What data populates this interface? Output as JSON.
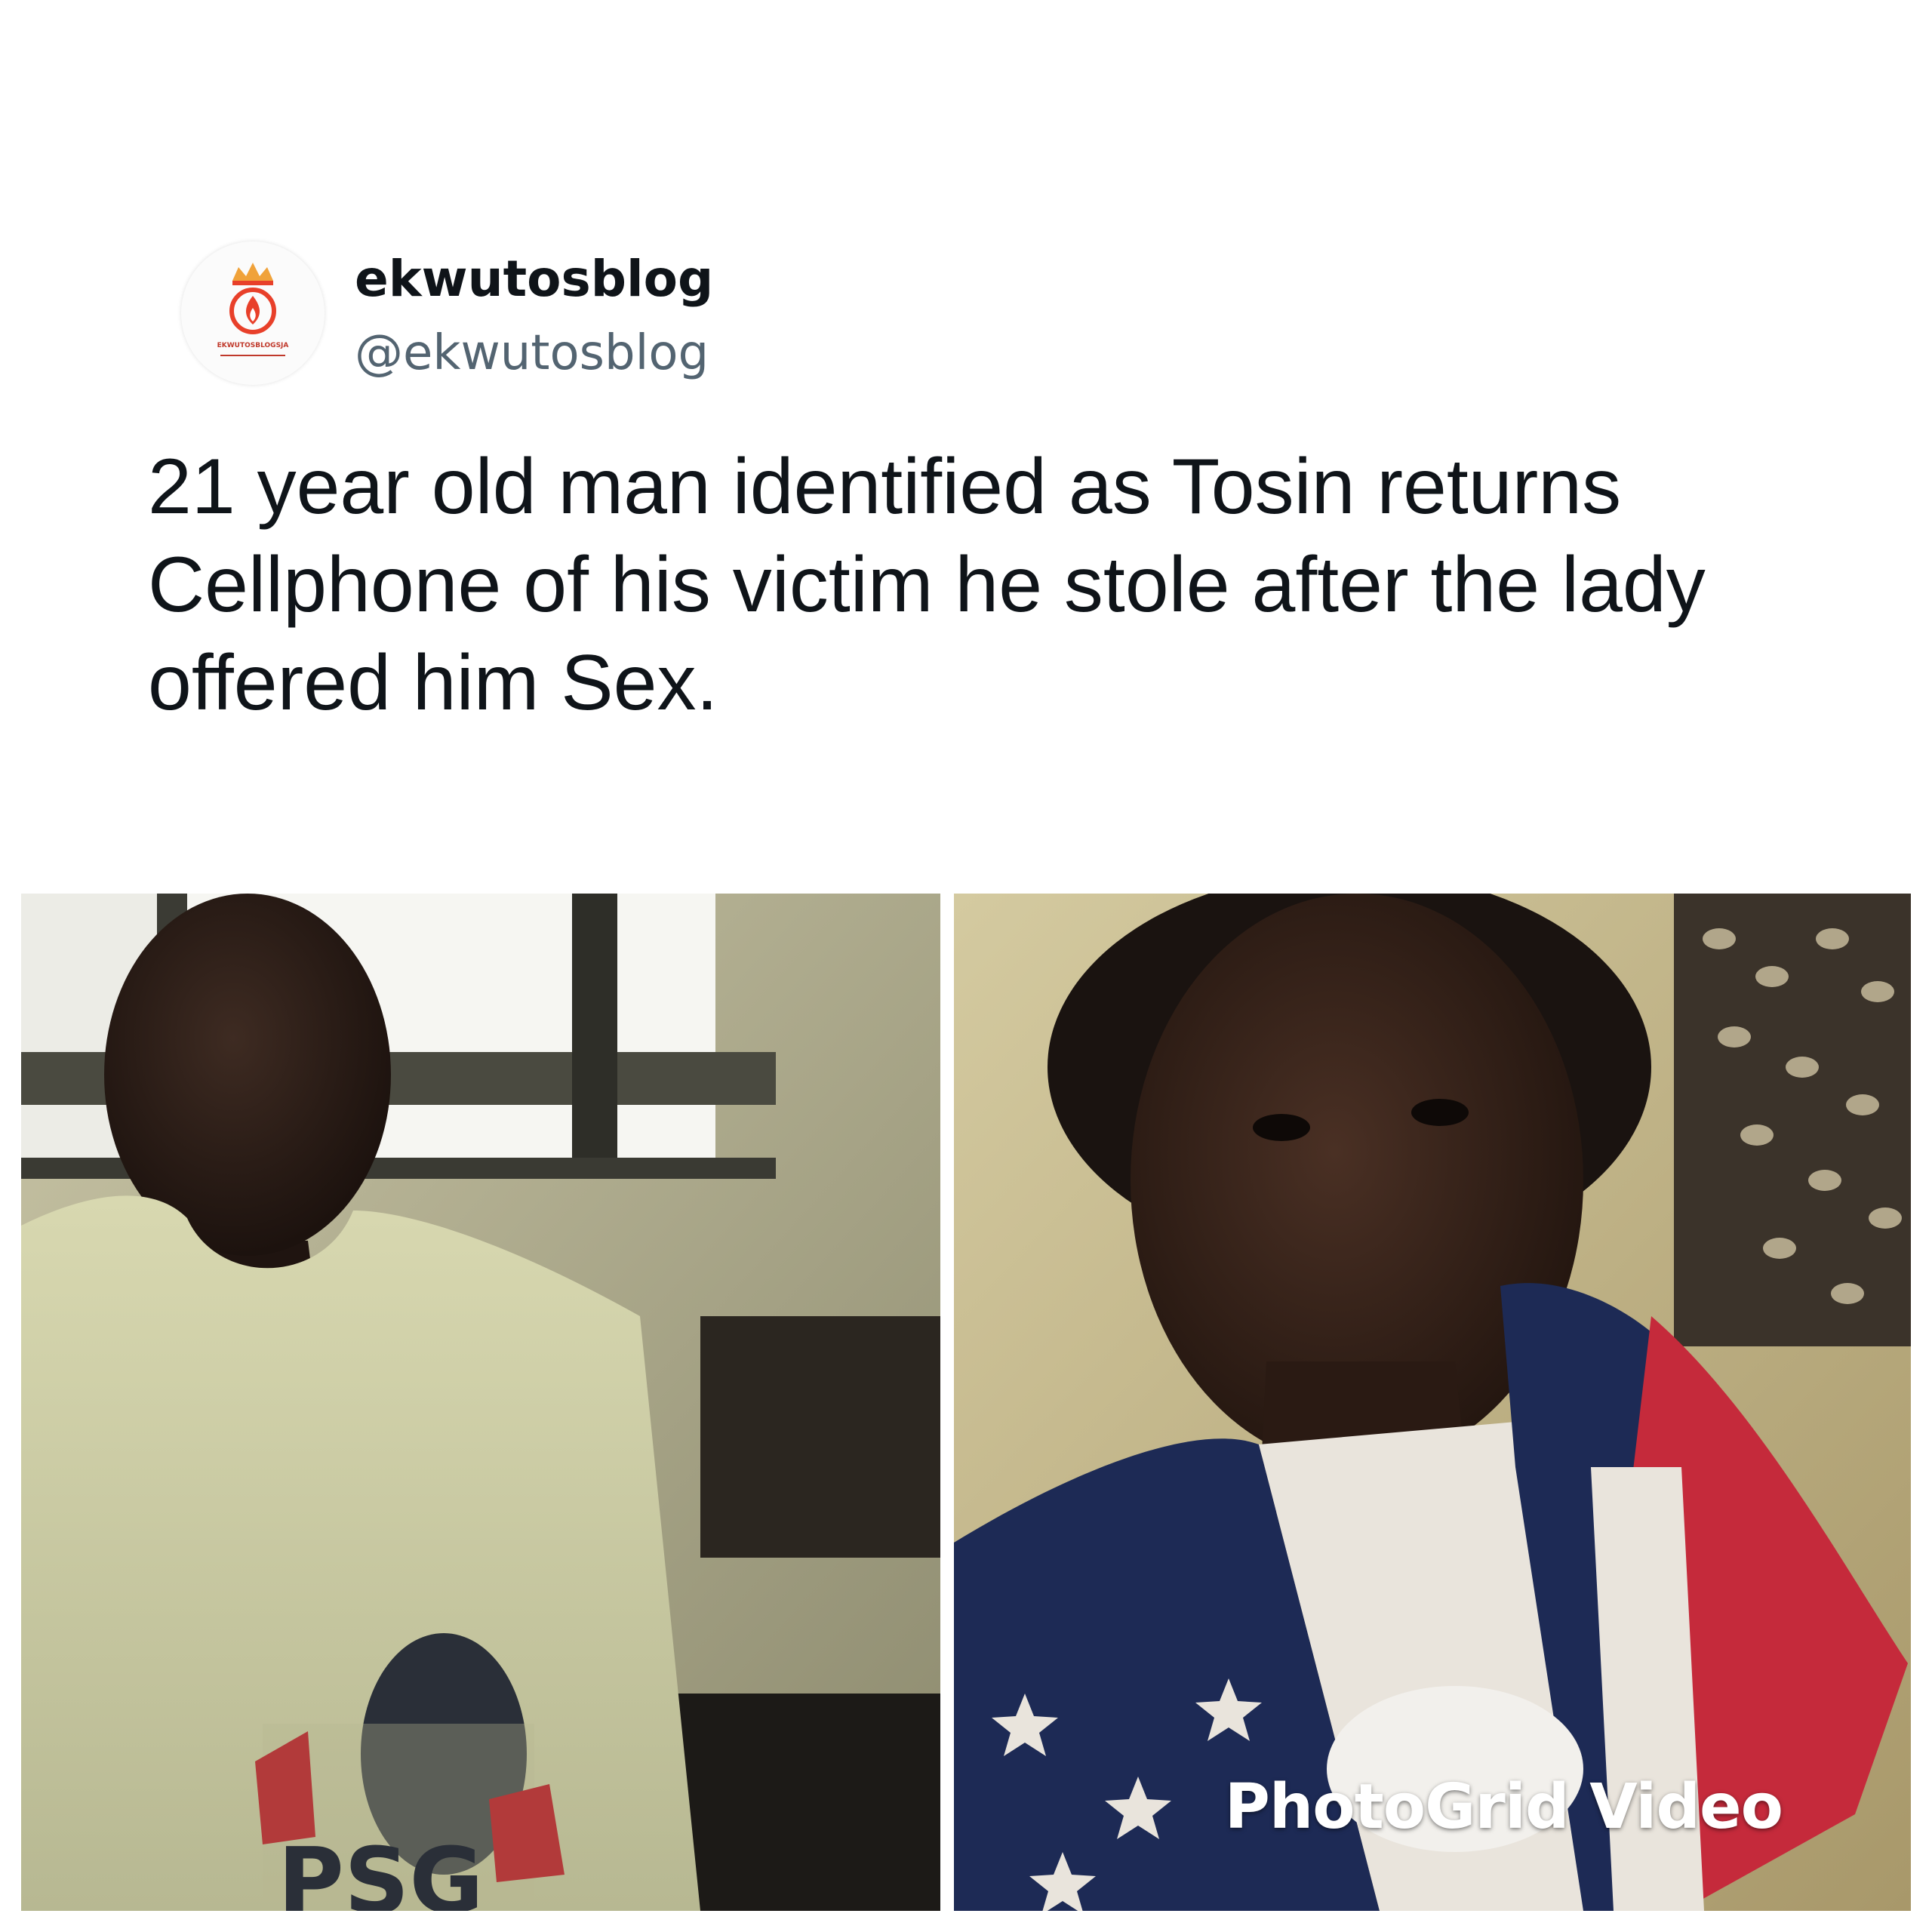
{
  "tweet": {
    "author": {
      "display_name": "ekwutosblog",
      "handle": "@ekwutosblog",
      "avatar_logo_text": "EKWUTOSBLOGSJA"
    },
    "text": "21 year old man identified as Tosin returns Cellphone of his victim he stole after the lady offered him Sex.",
    "media": {
      "watermark": "PhotoGrid Video",
      "shirt_print": "PSG"
    }
  },
  "colors": {
    "text_primary": "#0f1419",
    "text_secondary": "#536471",
    "logo_accent": "#e8402a"
  }
}
